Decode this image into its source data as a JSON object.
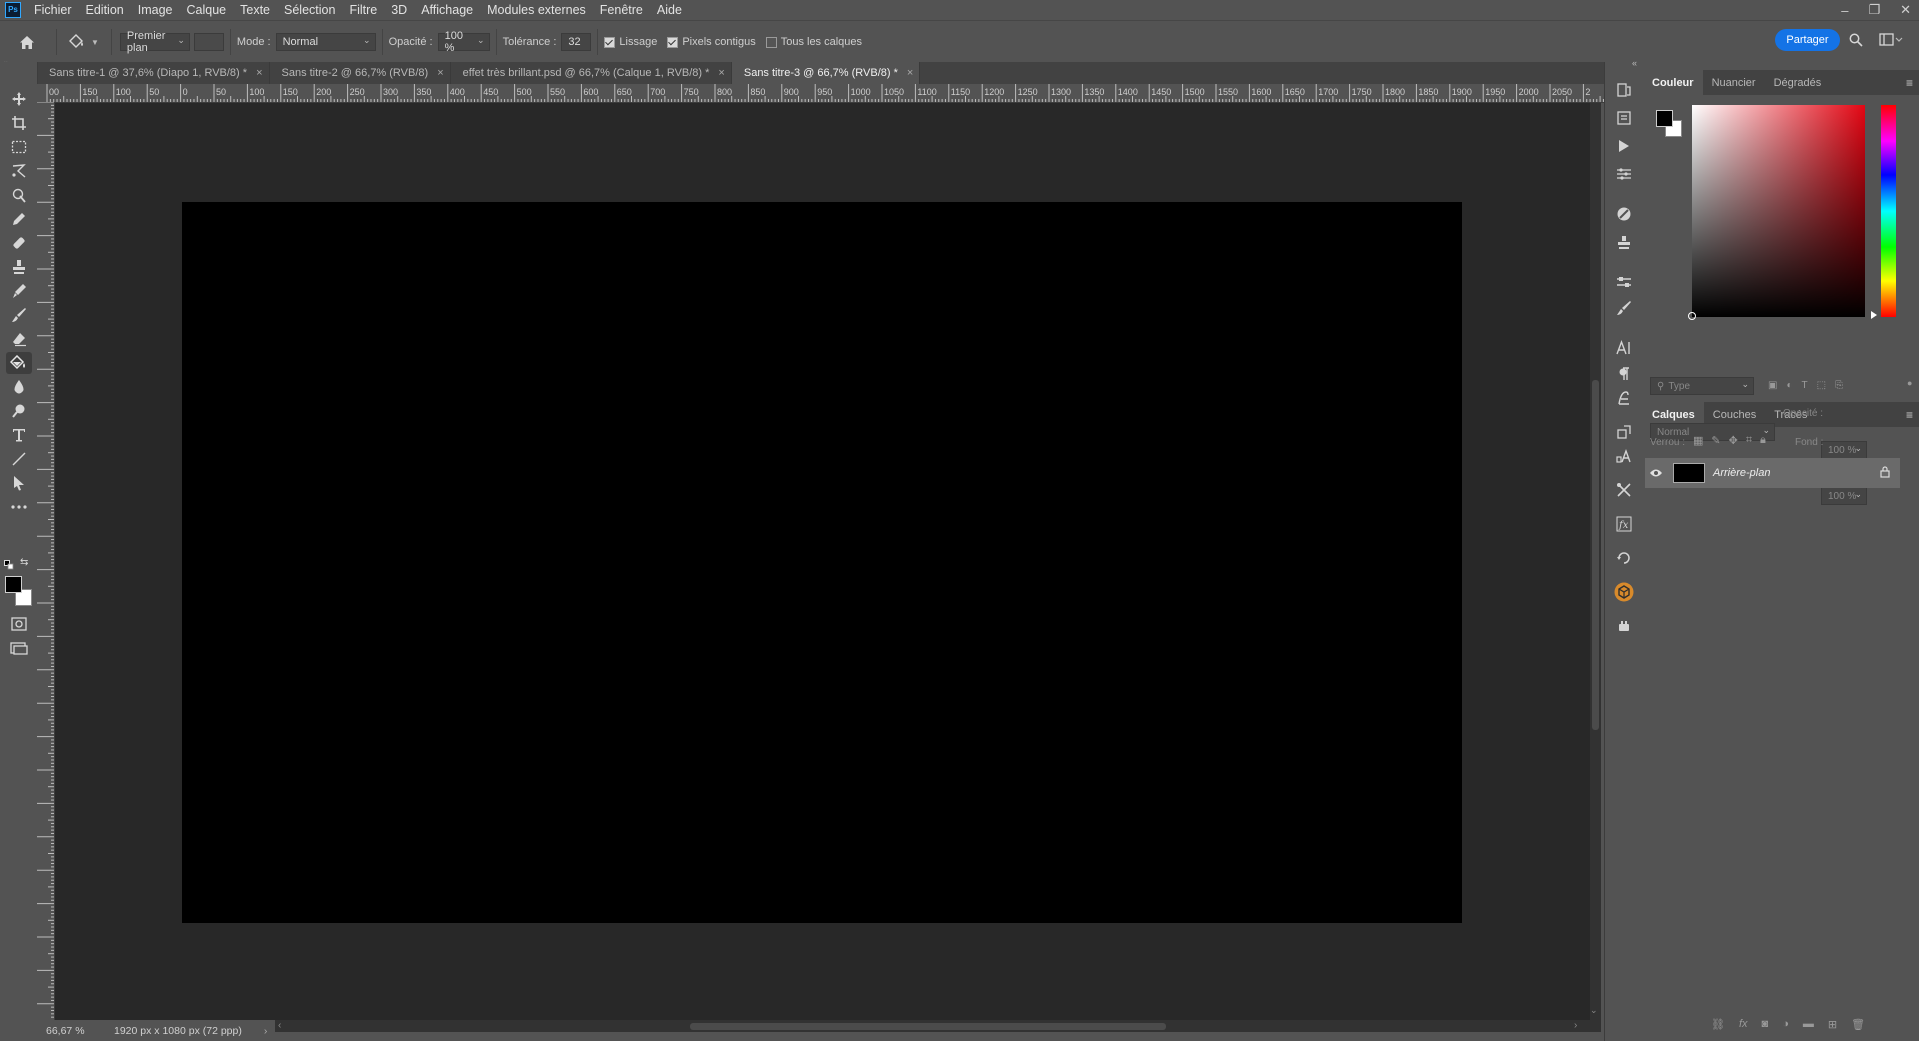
{
  "app": {
    "logo": "Ps"
  },
  "menu": [
    "Fichier",
    "Edition",
    "Image",
    "Calque",
    "Texte",
    "Sélection",
    "Filtre",
    "3D",
    "Affichage",
    "Modules externes",
    "Fenêtre",
    "Aide"
  ],
  "window_controls": {
    "minimize": "–",
    "restore": "❐",
    "close": "✕"
  },
  "options": {
    "fill_source": "Premier plan",
    "mode_label": "Mode :",
    "mode_value": "Normal",
    "opacity_label": "Opacité :",
    "opacity_value": "100 %",
    "tolerance_label": "Tolérance :",
    "tolerance_value": "32",
    "antialias_label": "Lissage",
    "contiguous_label": "Pixels contigus",
    "all_layers_label": "Tous les calques",
    "share_label": "Partager"
  },
  "tabs": [
    {
      "label": "Sans titre-1 @ 37,6% (Diapo 1, RVB/8) *",
      "active": false
    },
    {
      "label": "Sans titre-2 @ 66,7% (RVB/8)",
      "active": false
    },
    {
      "label": "effet très brillant.psd @ 66,7% (Calque 1, RVB/8) *",
      "active": false
    },
    {
      "label": "Sans titre-3 @ 66,7% (RVB/8) *",
      "active": true
    }
  ],
  "ruler_labels": [
    "00",
    "150",
    "100",
    "50",
    "0",
    "50",
    "100",
    "150",
    "200",
    "250",
    "300",
    "350",
    "400",
    "450",
    "500",
    "550",
    "600",
    "650",
    "700",
    "750",
    "800",
    "850",
    "900",
    "950",
    "1000",
    "1050",
    "1100",
    "1150",
    "1200",
    "1250",
    "1300",
    "1350",
    "1400",
    "1450",
    "1500",
    "1550",
    "1600",
    "1650",
    "1700",
    "1750",
    "1800",
    "1850",
    "1900",
    "1950",
    "2000",
    "2050",
    "2"
  ],
  "status": {
    "zoom": "66,67 %",
    "doc_info": "1920 px x 1080 px (72 ppp)"
  },
  "color_panel": {
    "tabs": [
      "Couleur",
      "Nuancier",
      "Dégradés"
    ],
    "foreground": "#000000",
    "background": "#ffffff"
  },
  "layers_panel": {
    "tabs": [
      "Calques",
      "Couches",
      "Tracés"
    ],
    "filter_placeholder": "Type",
    "blend_mode": "Normal",
    "opacity_label": "Opacité :",
    "opacity_value": "100 %",
    "lock_label": "Verrou :",
    "fill_label": "Fond :",
    "fill_value": "100 %",
    "layers": [
      {
        "name": "Arrière-plan",
        "visible": true,
        "locked": true
      }
    ]
  }
}
